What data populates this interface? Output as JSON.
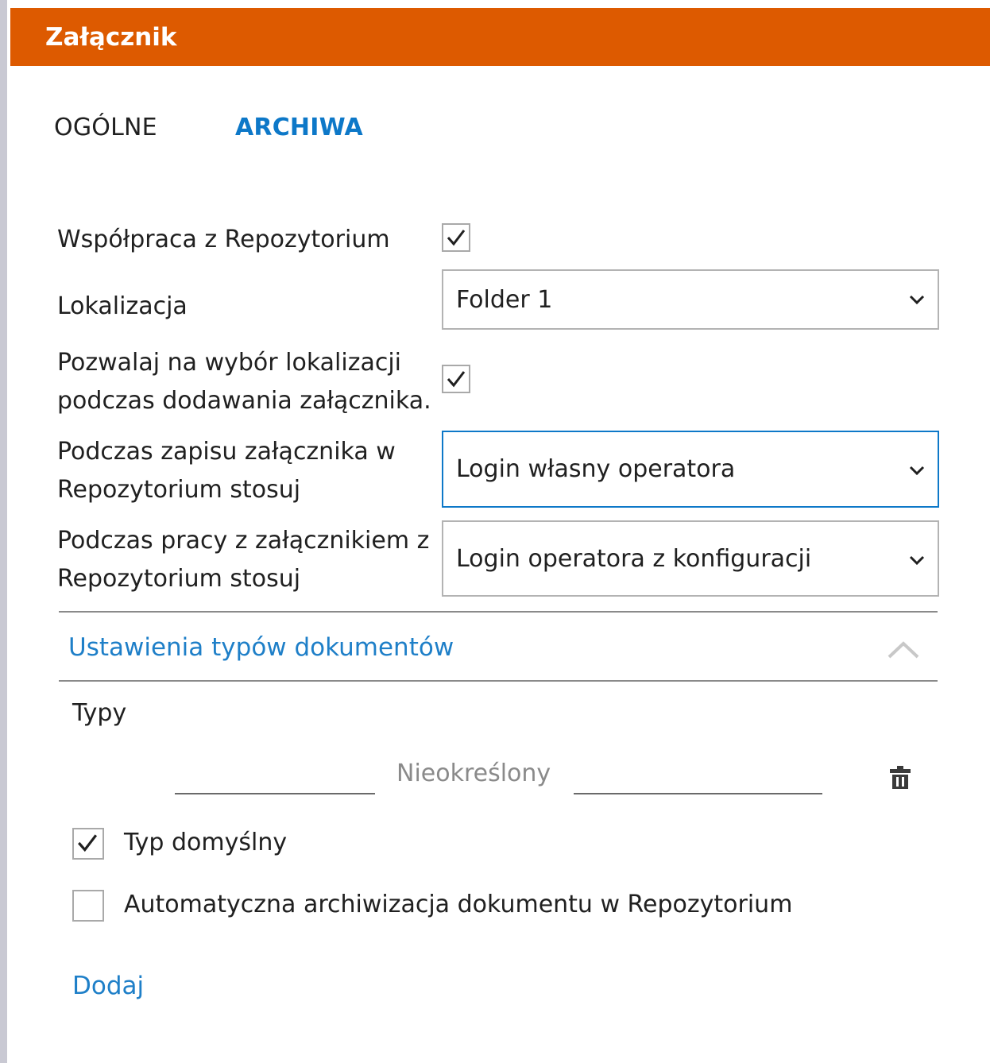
{
  "window": {
    "title": "Załącznik"
  },
  "tabs": [
    {
      "label": "OGÓLNE",
      "active": false
    },
    {
      "label": "ARCHIWA",
      "active": true
    }
  ],
  "form": {
    "repo_cooperation": {
      "label": "Współpraca z Repozytorium",
      "checked": true
    },
    "location": {
      "label": "Lokalizacja",
      "value": "Folder 1"
    },
    "allow_location_choice": {
      "label_line1": "Pozwalaj na wybór lokalizacji",
      "label_line2": "podczas dodawania załącznika.",
      "checked": true
    },
    "save_login": {
      "label_line1": "Podczas zapisu załącznika w",
      "label_line2": "Repozytorium stosuj",
      "value": "Login własny operatora"
    },
    "work_login": {
      "label_line1": "Podczas pracy z załącznikiem z",
      "label_line2": "Repozytorium stosuj",
      "value": "Login operatora z konfiguracji"
    }
  },
  "doc_types_section": {
    "title": "Ustawienia typów dokumentów",
    "types_label": "Typy",
    "type_value": "Nieokreślony",
    "default_type": {
      "label": "Typ domyślny",
      "checked": true
    },
    "auto_archive": {
      "label": "Automatyczna archiwizacja dokumentu w Repozytorium",
      "checked": false
    },
    "add_label": "Dodaj"
  },
  "colors": {
    "header": "#dd5a00",
    "accent": "#0d78c8",
    "link": "#1e7fc8"
  }
}
